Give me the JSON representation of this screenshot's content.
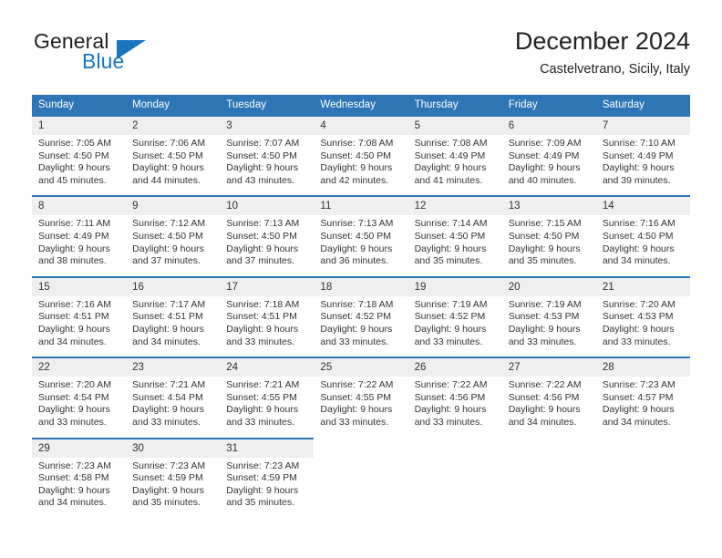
{
  "brand": {
    "name_part1": "General",
    "name_part2": "Blue",
    "accent_color": "#1b75bc",
    "logo_icon": "triangle-flag-icon"
  },
  "header": {
    "title": "December 2024",
    "subtitle": "Castelvetrano, Sicily, Italy"
  },
  "theme": {
    "header_row_bg": "#2e75b6",
    "daynum_row_bg": "#efefef",
    "text_color": "#333333"
  },
  "calendar": {
    "weekday_headers": [
      "Sunday",
      "Monday",
      "Tuesday",
      "Wednesday",
      "Thursday",
      "Friday",
      "Saturday"
    ],
    "weeks": [
      [
        {
          "day": "1",
          "sunrise": "Sunrise: 7:05 AM",
          "sunset": "Sunset: 4:50 PM",
          "daylight1": "Daylight: 9 hours",
          "daylight2": "and 45 minutes."
        },
        {
          "day": "2",
          "sunrise": "Sunrise: 7:06 AM",
          "sunset": "Sunset: 4:50 PM",
          "daylight1": "Daylight: 9 hours",
          "daylight2": "and 44 minutes."
        },
        {
          "day": "3",
          "sunrise": "Sunrise: 7:07 AM",
          "sunset": "Sunset: 4:50 PM",
          "daylight1": "Daylight: 9 hours",
          "daylight2": "and 43 minutes."
        },
        {
          "day": "4",
          "sunrise": "Sunrise: 7:08 AM",
          "sunset": "Sunset: 4:50 PM",
          "daylight1": "Daylight: 9 hours",
          "daylight2": "and 42 minutes."
        },
        {
          "day": "5",
          "sunrise": "Sunrise: 7:08 AM",
          "sunset": "Sunset: 4:49 PM",
          "daylight1": "Daylight: 9 hours",
          "daylight2": "and 41 minutes."
        },
        {
          "day": "6",
          "sunrise": "Sunrise: 7:09 AM",
          "sunset": "Sunset: 4:49 PM",
          "daylight1": "Daylight: 9 hours",
          "daylight2": "and 40 minutes."
        },
        {
          "day": "7",
          "sunrise": "Sunrise: 7:10 AM",
          "sunset": "Sunset: 4:49 PM",
          "daylight1": "Daylight: 9 hours",
          "daylight2": "and 39 minutes."
        }
      ],
      [
        {
          "day": "8",
          "sunrise": "Sunrise: 7:11 AM",
          "sunset": "Sunset: 4:49 PM",
          "daylight1": "Daylight: 9 hours",
          "daylight2": "and 38 minutes."
        },
        {
          "day": "9",
          "sunrise": "Sunrise: 7:12 AM",
          "sunset": "Sunset: 4:50 PM",
          "daylight1": "Daylight: 9 hours",
          "daylight2": "and 37 minutes."
        },
        {
          "day": "10",
          "sunrise": "Sunrise: 7:13 AM",
          "sunset": "Sunset: 4:50 PM",
          "daylight1": "Daylight: 9 hours",
          "daylight2": "and 37 minutes."
        },
        {
          "day": "11",
          "sunrise": "Sunrise: 7:13 AM",
          "sunset": "Sunset: 4:50 PM",
          "daylight1": "Daylight: 9 hours",
          "daylight2": "and 36 minutes."
        },
        {
          "day": "12",
          "sunrise": "Sunrise: 7:14 AM",
          "sunset": "Sunset: 4:50 PM",
          "daylight1": "Daylight: 9 hours",
          "daylight2": "and 35 minutes."
        },
        {
          "day": "13",
          "sunrise": "Sunrise: 7:15 AM",
          "sunset": "Sunset: 4:50 PM",
          "daylight1": "Daylight: 9 hours",
          "daylight2": "and 35 minutes."
        },
        {
          "day": "14",
          "sunrise": "Sunrise: 7:16 AM",
          "sunset": "Sunset: 4:50 PM",
          "daylight1": "Daylight: 9 hours",
          "daylight2": "and 34 minutes."
        }
      ],
      [
        {
          "day": "15",
          "sunrise": "Sunrise: 7:16 AM",
          "sunset": "Sunset: 4:51 PM",
          "daylight1": "Daylight: 9 hours",
          "daylight2": "and 34 minutes."
        },
        {
          "day": "16",
          "sunrise": "Sunrise: 7:17 AM",
          "sunset": "Sunset: 4:51 PM",
          "daylight1": "Daylight: 9 hours",
          "daylight2": "and 34 minutes."
        },
        {
          "day": "17",
          "sunrise": "Sunrise: 7:18 AM",
          "sunset": "Sunset: 4:51 PM",
          "daylight1": "Daylight: 9 hours",
          "daylight2": "and 33 minutes."
        },
        {
          "day": "18",
          "sunrise": "Sunrise: 7:18 AM",
          "sunset": "Sunset: 4:52 PM",
          "daylight1": "Daylight: 9 hours",
          "daylight2": "and 33 minutes."
        },
        {
          "day": "19",
          "sunrise": "Sunrise: 7:19 AM",
          "sunset": "Sunset: 4:52 PM",
          "daylight1": "Daylight: 9 hours",
          "daylight2": "and 33 minutes."
        },
        {
          "day": "20",
          "sunrise": "Sunrise: 7:19 AM",
          "sunset": "Sunset: 4:53 PM",
          "daylight1": "Daylight: 9 hours",
          "daylight2": "and 33 minutes."
        },
        {
          "day": "21",
          "sunrise": "Sunrise: 7:20 AM",
          "sunset": "Sunset: 4:53 PM",
          "daylight1": "Daylight: 9 hours",
          "daylight2": "and 33 minutes."
        }
      ],
      [
        {
          "day": "22",
          "sunrise": "Sunrise: 7:20 AM",
          "sunset": "Sunset: 4:54 PM",
          "daylight1": "Daylight: 9 hours",
          "daylight2": "and 33 minutes."
        },
        {
          "day": "23",
          "sunrise": "Sunrise: 7:21 AM",
          "sunset": "Sunset: 4:54 PM",
          "daylight1": "Daylight: 9 hours",
          "daylight2": "and 33 minutes."
        },
        {
          "day": "24",
          "sunrise": "Sunrise: 7:21 AM",
          "sunset": "Sunset: 4:55 PM",
          "daylight1": "Daylight: 9 hours",
          "daylight2": "and 33 minutes."
        },
        {
          "day": "25",
          "sunrise": "Sunrise: 7:22 AM",
          "sunset": "Sunset: 4:55 PM",
          "daylight1": "Daylight: 9 hours",
          "daylight2": "and 33 minutes."
        },
        {
          "day": "26",
          "sunrise": "Sunrise: 7:22 AM",
          "sunset": "Sunset: 4:56 PM",
          "daylight1": "Daylight: 9 hours",
          "daylight2": "and 33 minutes."
        },
        {
          "day": "27",
          "sunrise": "Sunrise: 7:22 AM",
          "sunset": "Sunset: 4:56 PM",
          "daylight1": "Daylight: 9 hours",
          "daylight2": "and 34 minutes."
        },
        {
          "day": "28",
          "sunrise": "Sunrise: 7:23 AM",
          "sunset": "Sunset: 4:57 PM",
          "daylight1": "Daylight: 9 hours",
          "daylight2": "and 34 minutes."
        }
      ],
      [
        {
          "day": "29",
          "sunrise": "Sunrise: 7:23 AM",
          "sunset": "Sunset: 4:58 PM",
          "daylight1": "Daylight: 9 hours",
          "daylight2": "and 34 minutes."
        },
        {
          "day": "30",
          "sunrise": "Sunrise: 7:23 AM",
          "sunset": "Sunset: 4:59 PM",
          "daylight1": "Daylight: 9 hours",
          "daylight2": "and 35 minutes."
        },
        {
          "day": "31",
          "sunrise": "Sunrise: 7:23 AM",
          "sunset": "Sunset: 4:59 PM",
          "daylight1": "Daylight: 9 hours",
          "daylight2": "and 35 minutes."
        },
        {
          "day": "",
          "sunrise": "",
          "sunset": "",
          "daylight1": "",
          "daylight2": ""
        },
        {
          "day": "",
          "sunrise": "",
          "sunset": "",
          "daylight1": "",
          "daylight2": ""
        },
        {
          "day": "",
          "sunrise": "",
          "sunset": "",
          "daylight1": "",
          "daylight2": ""
        },
        {
          "day": "",
          "sunrise": "",
          "sunset": "",
          "daylight1": "",
          "daylight2": ""
        }
      ]
    ]
  }
}
